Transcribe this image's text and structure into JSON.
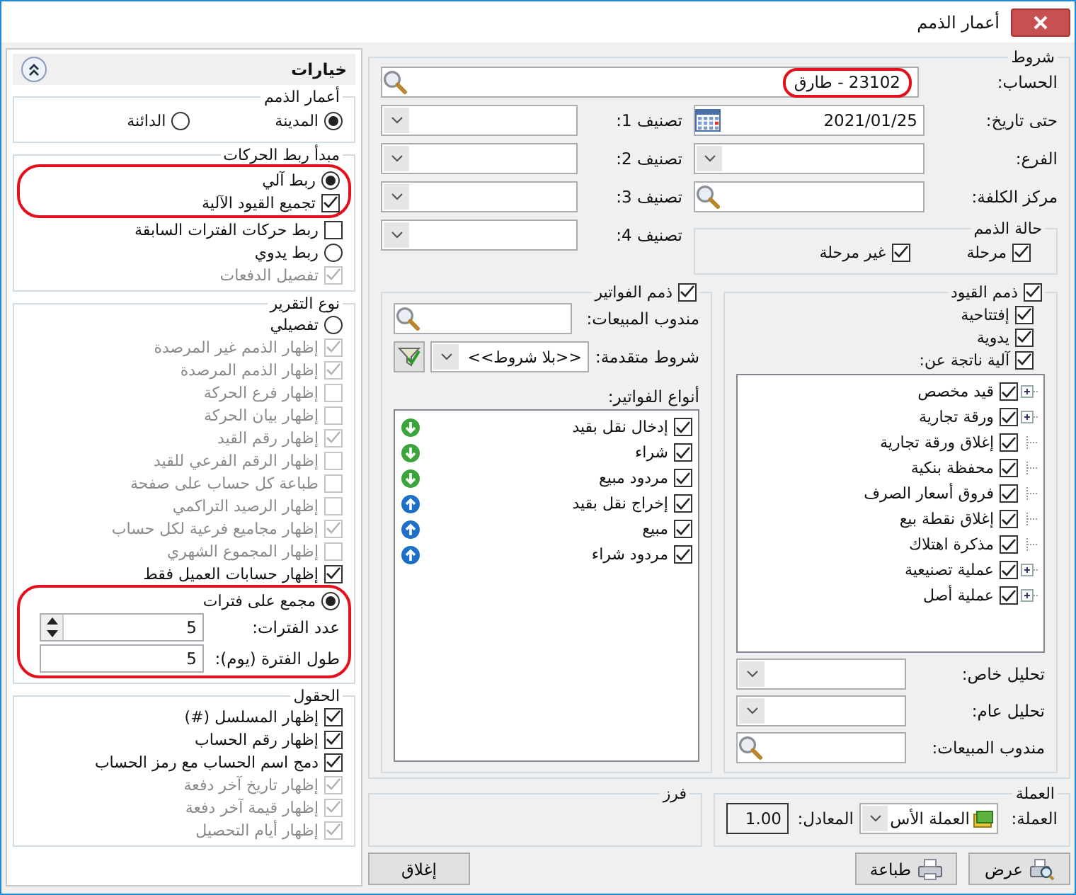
{
  "window": {
    "title": "أعمار الذمم"
  },
  "options_panel": {
    "title": "خيارات",
    "aging": {
      "title": "أعمار الذمم",
      "options": [
        {
          "label": "المدينة",
          "selected": true
        },
        {
          "label": "الدائنة",
          "selected": false
        }
      ]
    },
    "linking": {
      "title": "مبدأ ربط الحركات",
      "items": [
        {
          "kind": "radio",
          "label": "ربط آلي",
          "selected": true,
          "highlighted": true
        },
        {
          "kind": "checkbox",
          "label": "تجميع القيود الآلية",
          "checked": true,
          "disabled": false,
          "highlighted": true
        },
        {
          "kind": "checkbox",
          "label": "ربط حركات الفترات السابقة",
          "checked": false,
          "disabled": false,
          "highlighted": false
        },
        {
          "kind": "radio",
          "label": "ربط يدوي",
          "selected": false,
          "highlighted": false
        },
        {
          "kind": "checkbox",
          "label": "تفصيل الدفعات",
          "checked": true,
          "disabled": true,
          "highlighted": false
        }
      ]
    },
    "report_type": {
      "title": "نوع التقرير",
      "items": [
        {
          "kind": "radio",
          "label": "تفصيلي",
          "selected": false,
          "highlighted": false
        },
        {
          "kind": "checkbox",
          "label": "إظهار الذمم غير المرصدة",
          "checked": true,
          "disabled": true,
          "highlighted": false
        },
        {
          "kind": "checkbox",
          "label": "إظهار الذمم المرصدة",
          "checked": true,
          "disabled": true,
          "highlighted": false
        },
        {
          "kind": "checkbox",
          "label": "إظهار فرع الحركة",
          "checked": false,
          "disabled": true,
          "highlighted": false
        },
        {
          "kind": "checkbox",
          "label": "إظهار بيان الحركة",
          "checked": false,
          "disabled": true,
          "highlighted": false
        },
        {
          "kind": "checkbox",
          "label": "إظهار رقم القيد",
          "checked": true,
          "disabled": true,
          "highlighted": false
        },
        {
          "kind": "checkbox",
          "label": "إظهار الرقم الفرعي للقيد",
          "checked": false,
          "disabled": true,
          "highlighted": false
        },
        {
          "kind": "checkbox",
          "label": "طباعة كل حساب على صفحة",
          "checked": false,
          "disabled": true,
          "highlighted": false
        },
        {
          "kind": "checkbox",
          "label": "إظهار الرصيد التراكمي",
          "checked": false,
          "disabled": true,
          "highlighted": false
        },
        {
          "kind": "checkbox",
          "label": "إظهار مجاميع فرعية لكل حساب",
          "checked": true,
          "disabled": true,
          "highlighted": false
        },
        {
          "kind": "checkbox",
          "label": "إظهار المجموع الشهري",
          "checked": false,
          "disabled": true,
          "highlighted": false
        },
        {
          "kind": "checkbox",
          "label": "إظهار حسابات العميل فقط",
          "checked": true,
          "disabled": false,
          "highlighted": false
        },
        {
          "kind": "radio",
          "label": "مجمع على فترات",
          "selected": true,
          "highlighted": true
        },
        {
          "kind": "spinner",
          "label": "عدد الفترات:",
          "value": "5",
          "highlighted": true
        },
        {
          "kind": "number",
          "label": "طول الفترة (يوم):",
          "value": "5",
          "highlighted": true
        }
      ]
    },
    "fields": {
      "title": "الحقول",
      "items": [
        {
          "label": "إظهار المسلسل (#)",
          "checked": true,
          "disabled": false
        },
        {
          "label": "إظهار رقم الحساب",
          "checked": true,
          "disabled": false
        },
        {
          "label": "دمج اسم الحساب مع رمز الحساب",
          "checked": true,
          "disabled": false
        },
        {
          "label": "إظهار تاريخ آخر دفعة",
          "checked": true,
          "disabled": true
        },
        {
          "label": "إظهار قيمة آخر دفعة",
          "checked": true,
          "disabled": true
        },
        {
          "label": "إظهار أيام التحصيل",
          "checked": true,
          "disabled": true
        }
      ]
    }
  },
  "conditions": {
    "title": "شروط",
    "account": {
      "label": "الحساب:",
      "value": "23102 - طارق",
      "highlighted": true
    },
    "fields_right": [
      {
        "kind": "date",
        "label": "حتى تاريخ:",
        "value": "2021/01/25"
      },
      {
        "kind": "dropdown",
        "label": "الفرع:"
      },
      {
        "kind": "search",
        "label": "مركز الكلفة:"
      }
    ],
    "fields_left": [
      {
        "kind": "dropdown",
        "label": "تصنيف 1:"
      },
      {
        "kind": "dropdown",
        "label": "تصنيف 2:"
      },
      {
        "kind": "dropdown",
        "label": "تصنيف 3:"
      },
      {
        "kind": "dropdown",
        "label": "تصنيف 4:"
      }
    ],
    "status": {
      "title": "حالة الذمم",
      "options": [
        {
          "label": "مرحلة",
          "checked": true
        },
        {
          "label": "غير مرحلة",
          "checked": true
        }
      ]
    },
    "entries": {
      "label": "ذمم القيود",
      "checked": true,
      "options": [
        {
          "label": "إفتتاحية",
          "checked": true
        },
        {
          "label": "يدوية",
          "checked": true
        },
        {
          "label": "آلية ناتجة عن:",
          "checked": true
        }
      ],
      "tree": [
        {
          "label": "قيد مخصص",
          "checked": true,
          "has_children": true
        },
        {
          "label": "ورقة تجارية",
          "checked": true,
          "has_children": true
        },
        {
          "label": "إغلاق ورقة تجارية",
          "checked": true,
          "has_children": false
        },
        {
          "label": "محفظة بنكية",
          "checked": true,
          "has_children": false
        },
        {
          "label": "فروق أسعار الصرف",
          "checked": true,
          "has_children": false
        },
        {
          "label": "إغلاق نقطة بيع",
          "checked": true,
          "has_children": false
        },
        {
          "label": "مذكرة اهتلاك",
          "checked": true,
          "has_children": false
        },
        {
          "label": "عملية تصنيعية",
          "checked": true,
          "has_children": true
        },
        {
          "label": "عملية أصل",
          "checked": true,
          "has_children": true
        }
      ],
      "fields": [
        {
          "kind": "dropdown",
          "label": "تحليل خاص:"
        },
        {
          "kind": "dropdown",
          "label": "تحليل عام:"
        },
        {
          "kind": "search",
          "label": "مندوب المبيعات:"
        }
      ]
    },
    "invoices": {
      "label": "ذمم الفواتير",
      "checked": true,
      "sales_rep": {
        "label": "مندوب المبيعات:"
      },
      "advanced": {
        "label": "شروط متقدمة:",
        "value": "<<بلا شروط>>"
      },
      "types_label": "أنواع الفواتير:",
      "types": [
        {
          "label": "إدخال نقل بقيد",
          "checked": true,
          "kind": "in"
        },
        {
          "label": "شراء",
          "checked": true,
          "kind": "in"
        },
        {
          "label": "مردود مبيع",
          "checked": true,
          "kind": "in"
        },
        {
          "label": "إخراج نقل بقيد",
          "checked": true,
          "kind": "out"
        },
        {
          "label": "مبيع",
          "checked": true,
          "kind": "out"
        },
        {
          "label": "مردود شراء",
          "checked": true,
          "kind": "out"
        }
      ]
    }
  },
  "currency": {
    "title": "العملة",
    "label": "العملة:",
    "value": "العملة الأس",
    "rate_label": "المعادل:",
    "rate": "1.00"
  },
  "sort": {
    "title": "فرز"
  },
  "buttons": [
    {
      "kind": "view",
      "label": "عرض"
    },
    {
      "kind": "print",
      "label": "طباعة"
    },
    {
      "kind": "close",
      "label": "إغلاق"
    }
  ]
}
